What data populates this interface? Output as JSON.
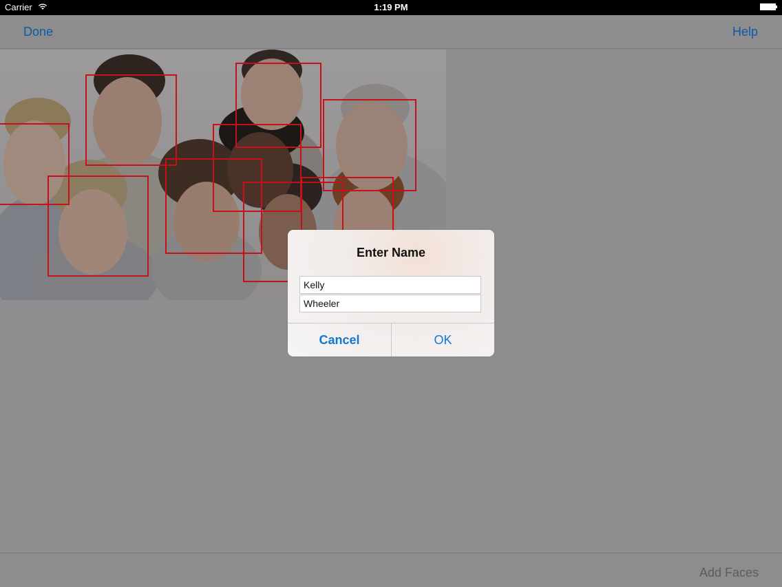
{
  "status_bar": {
    "carrier": "Carrier",
    "time": "1:19 PM"
  },
  "nav": {
    "done_label": "Done",
    "help_label": "Help"
  },
  "photo": {
    "description_icon": "group-photo",
    "face_box_color": "#c8101a"
  },
  "alert": {
    "title": "Enter Name",
    "first_name_value": "Kelly",
    "last_name_value": "Wheeler",
    "cancel_label": "Cancel",
    "ok_label": "OK"
  },
  "toolbar": {
    "add_faces_label": "Add Faces"
  },
  "colors": {
    "accent": "#0f59a7",
    "alert_button": "#1378cf",
    "dim_overlay": "#8e8d8f",
    "disabled_text": "#5c5c5e"
  }
}
